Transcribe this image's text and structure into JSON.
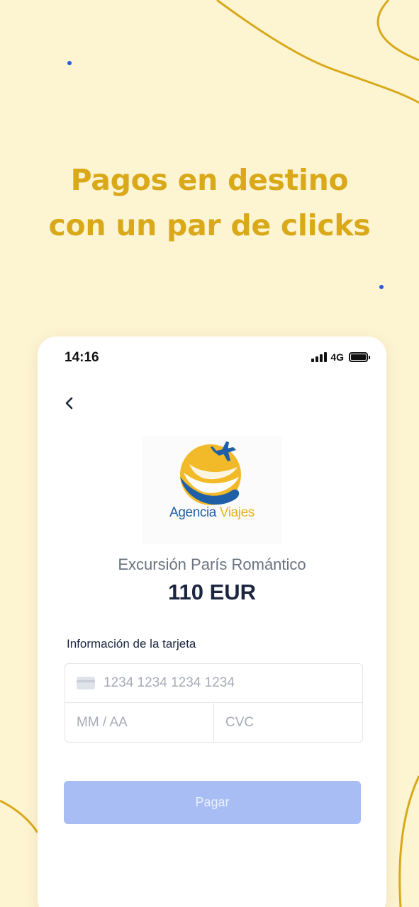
{
  "headline": {
    "line1": "Pagos en destino",
    "line2": "con un par de clicks"
  },
  "status_bar": {
    "time": "14:16",
    "network": "4G",
    "signal_icon": "signal-bars-icon",
    "battery_icon": "battery-icon"
  },
  "nav": {
    "back_icon": "chevron-left-icon"
  },
  "merchant": {
    "logo_text_1": "Agencia",
    "logo_text_2": "Viajes"
  },
  "order": {
    "product": "Excursión París Romántico",
    "price": "110 EUR"
  },
  "card_form": {
    "label": "Información de la tarjeta",
    "number_placeholder": "1234 1234 1234 1234",
    "expiry_placeholder": "MM / AA",
    "cvc_placeholder": "CVC",
    "card_icon": "credit-card-icon"
  },
  "pay_button": {
    "label": "Pagar"
  },
  "colors": {
    "background": "#fdf4d2",
    "headline": "#d9a91a",
    "button": "#a8bdf3",
    "dots": "#2a5bd7"
  }
}
